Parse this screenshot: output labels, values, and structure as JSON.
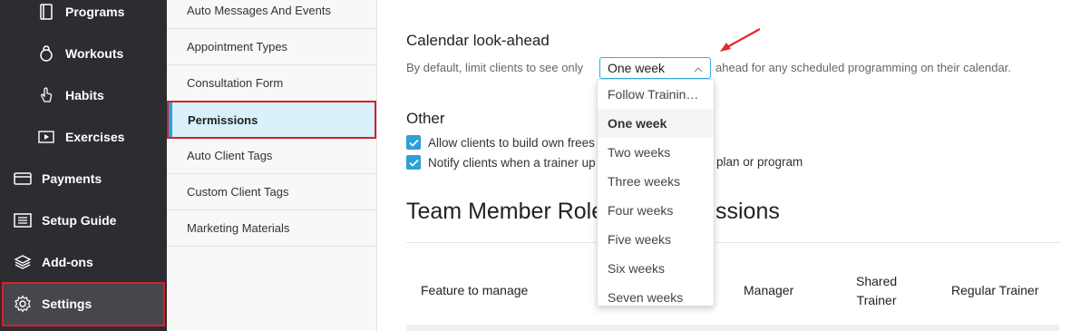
{
  "nav": {
    "items": [
      {
        "label": "Programs",
        "icon": "programs-icon"
      },
      {
        "label": "Workouts",
        "icon": "kettlebell-icon"
      },
      {
        "label": "Habits",
        "icon": "hand-icon"
      },
      {
        "label": "Exercises",
        "icon": "play-icon"
      },
      {
        "label": "Payments",
        "icon": "credit-card-icon"
      },
      {
        "label": "Setup Guide",
        "icon": "list-icon"
      },
      {
        "label": "Add-ons",
        "icon": "stack-icon"
      },
      {
        "label": "Settings",
        "icon": "gear-icon"
      }
    ],
    "active": "Settings"
  },
  "settings_menu": {
    "items": [
      "Auto Messages And Events",
      "Appointment Types",
      "Consultation Form",
      "Permissions",
      "Auto Client Tags",
      "Custom Client Tags",
      "Marketing Materials"
    ],
    "active": "Permissions"
  },
  "calendar": {
    "title": "Calendar look-ahead",
    "desc_before": "By default, limit clients to see only",
    "desc_after": "ahead for any scheduled programming on their calendar.",
    "selected": "One week",
    "options": [
      "Follow Trainin…",
      "One week",
      "Two weeks",
      "Three weeks",
      "Four weeks",
      "Five weeks",
      "Six weeks",
      "Seven weeks"
    ]
  },
  "other": {
    "title": "Other",
    "check1": "Allow clients to build own frees",
    "check2_a": "Notify clients when a trainer up",
    "check2_b": "plan or program"
  },
  "team": {
    "title_a": "Team Member Role",
    "title_b": "ssions",
    "columns": {
      "feature": "Feature to manage",
      "manager": "Manager",
      "shared_1": "Shared",
      "shared_2": "Trainer",
      "regular": "Regular Trainer"
    }
  },
  "colors": {
    "sidebar_bg": "#2b2d31",
    "accent": "#2db0e8",
    "highlight": "#d7202b",
    "annotation_arrow": "#e8262b"
  }
}
